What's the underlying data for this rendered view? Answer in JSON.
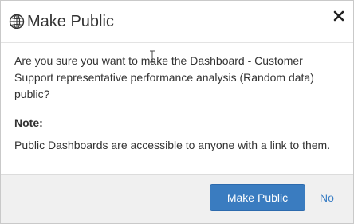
{
  "dialog": {
    "title": "Make Public",
    "title_icon": "globe-icon",
    "close_icon": "close-icon",
    "question": "Are you sure you want to make the Dashboard - Customer Support representative performance analysis (Random data) public?",
    "note_label": "Note:",
    "note_text": "Public Dashboards are accessible to anyone with a link to them."
  },
  "footer": {
    "confirm_label": "Make Public",
    "cancel_label": "No"
  },
  "colors": {
    "primary_button": "#3a7cc0",
    "link": "#3b7ec4",
    "footer_bg": "#f0f0f0",
    "text": "#333333"
  }
}
